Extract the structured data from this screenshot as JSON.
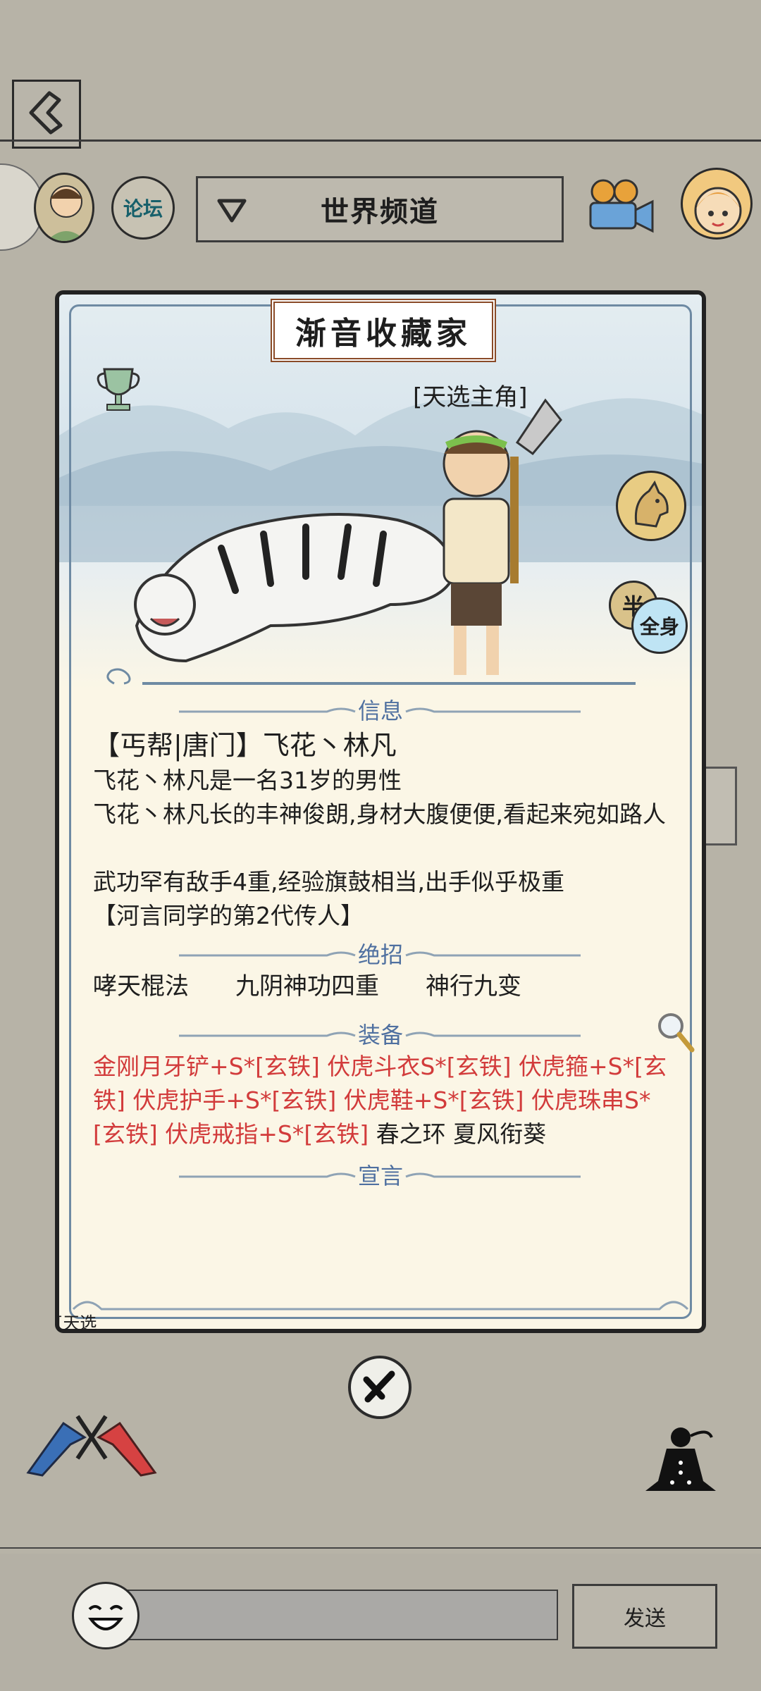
{
  "header": {
    "channel_name": "世界频道",
    "forum_label": "论坛"
  },
  "modal": {
    "title": "渐音收藏家",
    "role_tag": "[天选主角]",
    "view_toggle": {
      "left": "半",
      "right": "全身"
    },
    "sections": {
      "info": "信息",
      "skills": "绝招",
      "equipment": "装备",
      "declaration": "宣言"
    },
    "info": {
      "name_line": "【丐帮|唐门】飞花丶林凡",
      "age_line": "飞花丶林凡是一名31岁的男性",
      "looks_line": "飞花丶林凡长的丰神俊朗,身材大腹便便,看起来宛如路人",
      "combat_line": "武功罕有敌手4重,经验旗鼓相当,出手似乎极重",
      "lineage_line": "【河言同学的第2代传人】"
    },
    "skills": [
      "哮天棍法",
      "九阴神功四重",
      "神行九变"
    ],
    "equipment_red": "金刚月牙铲+S*[玄铁]  伏虎斗衣S*[玄铁]  伏虎箍+S*[玄铁]  伏虎护手+S*[玄铁]  伏虎鞋+S*[玄铁]  伏虎珠串S*[玄铁]  伏虎戒指+S*[玄铁]",
    "equipment_black": "  春之环  夏风衔葵",
    "declaration": ""
  },
  "background": {
    "bottom_tag": "[天选"
  },
  "bottom_bar": {
    "input_value": "",
    "send_label": "发送"
  },
  "colors": {
    "background": "#b7b3a7",
    "section_title": "#4f70a0",
    "equipment_red": "#d23b3b",
    "panel": "#fbf6e6"
  }
}
